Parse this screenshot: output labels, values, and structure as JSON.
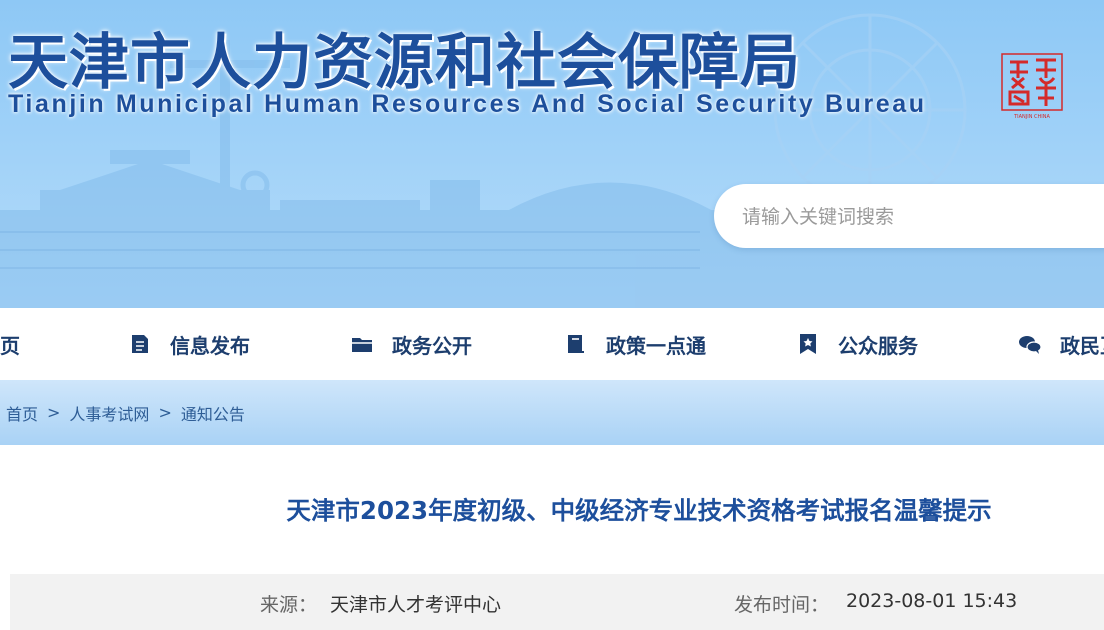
{
  "header": {
    "title": "天津市人力资源和社会保障局",
    "subtitle": "Tianjin Municipal Human Resources And Social Security Bureau",
    "seal_text": "天津",
    "seal_caption": "TIANJIN CHINA"
  },
  "search": {
    "placeholder": "请输入关键词搜索",
    "value": ""
  },
  "nav": {
    "items": [
      {
        "label": "首页",
        "icon": "home-icon"
      },
      {
        "label": "信息发布",
        "icon": "document-icon"
      },
      {
        "label": "政务公开",
        "icon": "folder-icon"
      },
      {
        "label": "政策一点通",
        "icon": "book-icon"
      },
      {
        "label": "公众服务",
        "icon": "bookmark-star-icon"
      },
      {
        "label": "政民互动",
        "icon": "chat-icon"
      }
    ]
  },
  "breadcrumb": {
    "items": [
      "首页",
      "人事考试网",
      "通知公告"
    ],
    "separator": ">"
  },
  "article": {
    "title": "天津市2023年度初级、中级经济专业技术资格考试报名温馨提示",
    "source_label": "来源：",
    "source_value": "天津市人才考评中心",
    "date_label": "发布时间：",
    "date_value": "2023-08-01 15:43"
  },
  "colors": {
    "brand_blue": "#1d4f9c",
    "nav_text": "#1d3e6e",
    "banner_sky": "#9fd1f8",
    "breadcrumb_bg": "#a9d2f5",
    "seal_red": "#d42a2a"
  }
}
